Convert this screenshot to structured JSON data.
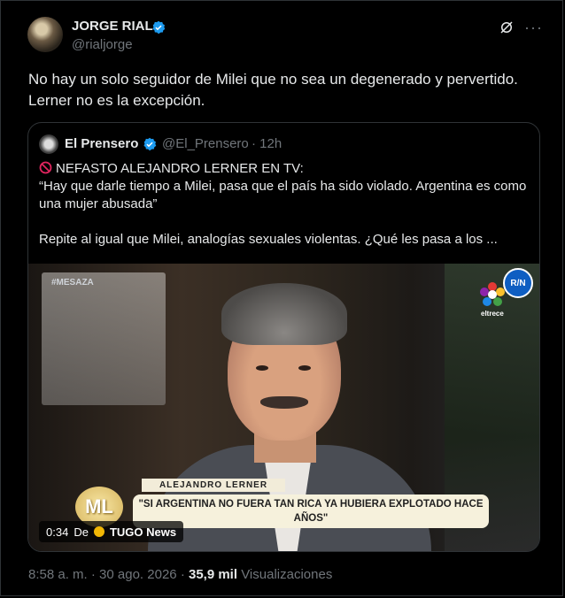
{
  "author": {
    "name": "JORGE RIAL",
    "handle": "@rialjorge"
  },
  "tweet": {
    "text": "No hay un solo seguidor de Milei que no sea un degenerado y pervertido. Lerner no es la excepción."
  },
  "quote": {
    "name": "El Prensero",
    "handle": "@El_Prensero",
    "time": "· 12h",
    "line1": "NEFASTO ALEJANDRO LERNER EN TV:",
    "line2": "“Hay que darle tiempo a Milei, pasa que el país ha sido violado. Argentina es como una mujer abusada”",
    "line3": "Repite al igual que Milei, analogías sexuales violentas. ¿Qué les pasa a los ...",
    "video": {
      "hashtag": "#MESAZA",
      "channel": "eltrece",
      "badge": "R/N",
      "lower_name": "ALEJANDRO LERNER",
      "lower_quote": "\"SI ARGENTINA NO FUERA TAN RICA YA HUBIERA EXPLOTADO HACE AÑOS\"",
      "logo": "ML",
      "timecode": "0:34",
      "source_prefix": "De",
      "source_name": "TUGO News"
    }
  },
  "footer": {
    "time": "8:58 a. m.",
    "sep1": "·",
    "date": "30 ago. 2026",
    "sep2": "·",
    "views_count": "35,9 mil",
    "views_label": "Visualizaciones"
  },
  "colors": {
    "background": "#000000",
    "text": "#e7e9ea",
    "muted": "#71767b",
    "verified": "#1d9bf0",
    "border": "#2f3336"
  },
  "icons": [
    "verified-icon",
    "grok-icon",
    "more-icon",
    "no-entry-icon",
    "tugo-icon"
  ]
}
